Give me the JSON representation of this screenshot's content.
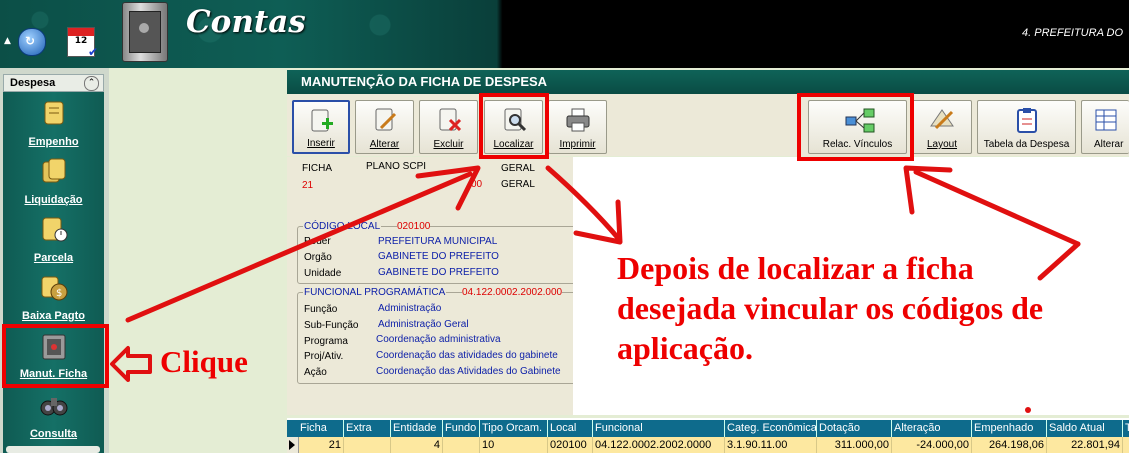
{
  "header": {
    "app_title": "Contas",
    "organization": "4. PREFEITURA DO"
  },
  "sidebar": {
    "section": "Despesa",
    "items": [
      {
        "label": "Empenho",
        "icon": "scroll-icon"
      },
      {
        "label": "Liquidação",
        "icon": "scroll-stack-icon"
      },
      {
        "label": "Parcela",
        "icon": "scroll-clock-icon"
      },
      {
        "label": "Baixa Pagto",
        "icon": "money-bag-icon"
      },
      {
        "label": "Manut. Ficha",
        "icon": "safe-icon"
      },
      {
        "label": "Consulta",
        "icon": "binoculars-icon"
      }
    ]
  },
  "panel": {
    "title": "MANUTENÇÃO DA FICHA DE DESPESA"
  },
  "toolbar": {
    "inserir": "Inserir",
    "alterar": "Alterar",
    "excluir": "Excluir",
    "localizar": "Localizar",
    "imprimir": "Imprimir",
    "relac_vinculos": "Relac. Vínculos",
    "layout": "Layout",
    "tabela_despesa": "Tabela da Despesa",
    "alterar2": "Alterar"
  },
  "form": {
    "ficha_label": "FICHA",
    "ficha_value": "21",
    "plano_label": "PLANO SCPI",
    "plano_value": "00",
    "geral_label": "GERAL",
    "geral_value": "GERAL",
    "codigo_local_label": "CÓDIGO LOCAL",
    "codigo_local_value": "020100",
    "poder_label": "Poder",
    "poder_value": "PREFEITURA MUNICIPAL",
    "orgao_label": "Orgão",
    "orgao_value": "GABINETE DO PREFEITO",
    "unidade_label": "Unidade",
    "unidade_value": "GABINETE DO PREFEITO",
    "funcional_label": "FUNCIONAL PROGRAMÁTICA",
    "funcional_value": "04.122.0002.2002.000",
    "funcao_label": "Função",
    "funcao_value": "Administração",
    "subfuncao_label": "Sub-Função",
    "subfuncao_value": "Administração Geral",
    "programa_label": "Programa",
    "programa_value": "Coordenação administrativa",
    "projativ_label": "Proj/Ativ.",
    "projativ_value": "Coordenação das atividades do gabinete",
    "acao_label": "Ação",
    "acao_value": "Coordenação das Atividades do Gabinete"
  },
  "grid": {
    "columns": [
      "Ficha",
      "Extra",
      "Entidade",
      "Fundo",
      "Tipo Orcam.",
      "Local",
      "Funcional",
      "Categ. Econômica",
      "Dotação",
      "Alteração",
      "Empenhado",
      "Saldo Atual",
      "T"
    ],
    "row": [
      "21",
      "",
      "4",
      "",
      "10",
      "020100",
      "04.122.0002.2002.0000",
      "3.1.90.11.00",
      "311.000,00",
      "-24.000,00",
      "264.198,06",
      "22.801,94",
      ""
    ]
  },
  "annotations": {
    "click_text": "Clique",
    "note_line1": "Depois de localizar a ficha",
    "note_line2": "desejada vincular os códigos de",
    "note_line3": "aplicação.",
    "color": "#ee0000"
  }
}
